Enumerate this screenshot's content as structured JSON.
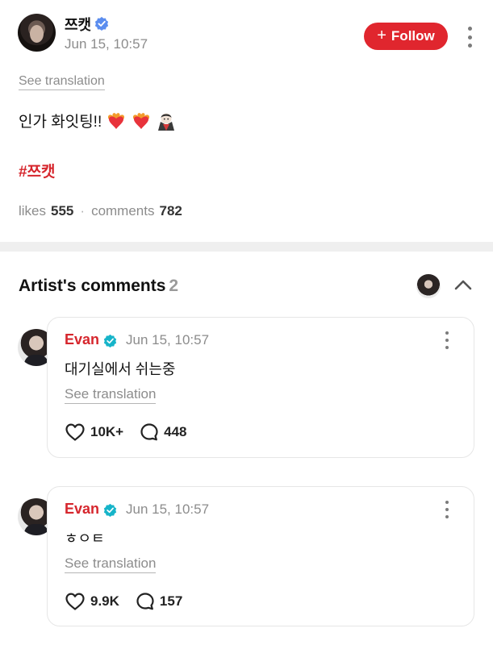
{
  "post": {
    "author": "쯔캣",
    "time": "Jun 15, 10:57",
    "follow_label": "Follow",
    "see_translation": "See translation",
    "text": "인가 화잇팅!!",
    "emojis": [
      "heart-on-fire-icon",
      "heart-on-fire-icon",
      "vampire-icon"
    ],
    "hashtag": "#쯔캣",
    "likes_label": "likes",
    "likes_count": "555",
    "separator": "·",
    "comments_label": "comments",
    "comments_count": "782"
  },
  "artist_comments": {
    "title": "Artist's comments",
    "count": "2",
    "items": [
      {
        "author": "Evan",
        "time": "Jun 15, 10:57",
        "text": "대기실에서 쉬는중",
        "see_translation": "See translation",
        "likes": "10K+",
        "replies": "448"
      },
      {
        "author": "Evan",
        "time": "Jun 15, 10:57",
        "text": "ㅎㅇㅌ",
        "see_translation": "See translation",
        "likes": "9.9K",
        "replies": "157"
      }
    ]
  },
  "colors": {
    "accent_red": "#e0262e",
    "artist_name_red": "#d6262d",
    "verified_blue": "#5b8def",
    "artist_verified_teal": "#16b4c9",
    "muted_gray": "#8c8c8c"
  }
}
